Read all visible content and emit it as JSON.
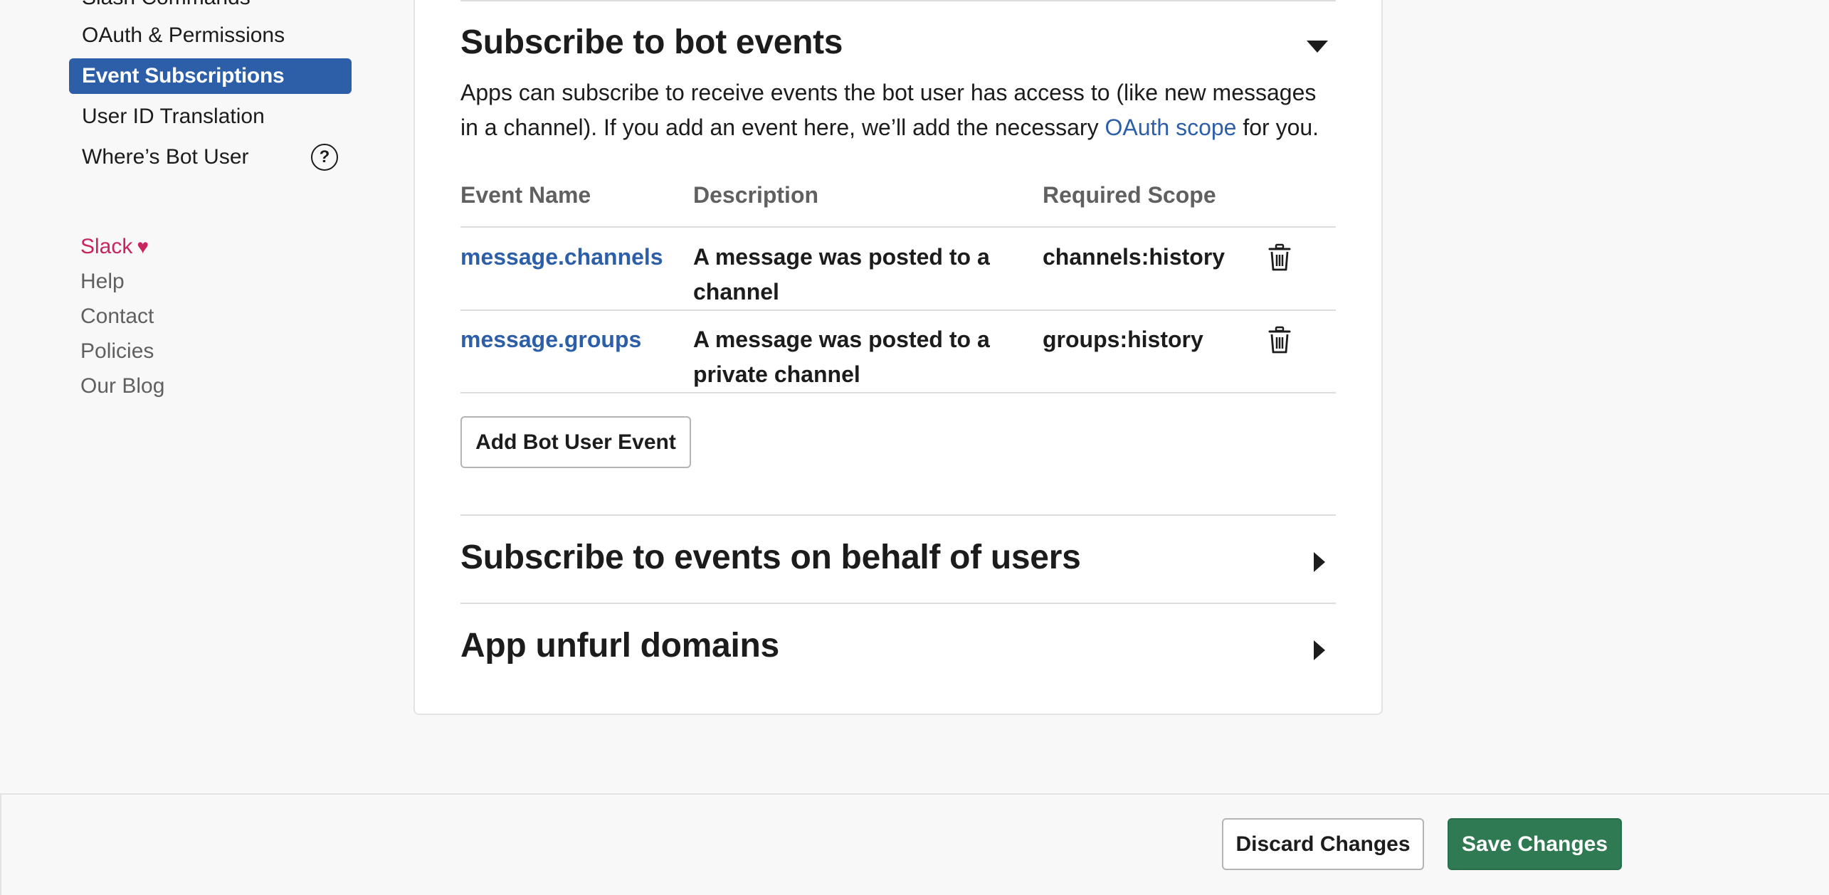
{
  "sidebar": {
    "items": [
      {
        "label": "Slash Commands"
      },
      {
        "label": "OAuth & Permissions"
      },
      {
        "label": "Event Subscriptions",
        "active": true
      },
      {
        "label": "User ID Translation"
      },
      {
        "label": "Where’s Bot User"
      }
    ],
    "help_glyph": "?",
    "footer": {
      "slack": "Slack",
      "heart": "♥",
      "help": "Help",
      "contact": "Contact",
      "policies": "Policies",
      "blog": "Our Blog"
    }
  },
  "bot_events": {
    "title": "Subscribe to bot events",
    "description_before": "Apps can subscribe to receive events the bot user has access to (like new messages in a channel). If you add an event here, we’ll add the necessary ",
    "description_link": "OAuth scope",
    "description_after": " for you.",
    "columns": [
      "Event Name",
      "Description",
      "Required Scope"
    ],
    "rows": [
      {
        "event": "message.channels",
        "description": "A message was posted to a channel",
        "scope": "channels:history"
      },
      {
        "event": "message.groups",
        "description": "A message was posted to a private channel",
        "scope": "groups:history"
      }
    ],
    "add_button": "Add Bot User Event"
  },
  "user_events": {
    "title": "Subscribe to events on behalf of users"
  },
  "unfurl": {
    "title": "App unfurl domains"
  },
  "footer_bar": {
    "discard": "Discard Changes",
    "save": "Save Changes"
  },
  "colors": {
    "accent": "#2c5fa8",
    "save_green": "#2f7a53",
    "slack_pink": "#c9245f"
  }
}
